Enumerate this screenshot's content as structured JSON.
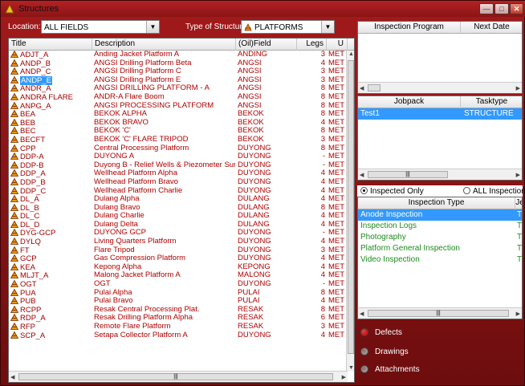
{
  "window": {
    "title": "Structures",
    "min": "—",
    "max": "□",
    "close": "✕"
  },
  "toolbar": {
    "location_label": "Location:",
    "location_value": "ALL FIELDS",
    "type_label": "Type of Structure:",
    "type_value": "PLATFORMS"
  },
  "grid": {
    "headers": [
      "Title",
      "Description",
      "(Oil)Field",
      "Legs",
      "U"
    ],
    "rows": [
      [
        "ADJT_A",
        "Anding Jacket Platform A",
        "ANDING",
        "3",
        "MET"
      ],
      [
        "ANDP_B",
        "ANGSI Drilling Platform Beta",
        "ANGSI",
        "4",
        "MET"
      ],
      [
        "ANDP_C",
        "ANGSI Drilling Platform C",
        "ANGSI",
        "3",
        "MET"
      ],
      [
        "ANDP_E",
        "ANGSI Drilling Platform E",
        "ANGSI",
        "3",
        "MET"
      ],
      [
        "ANDR_A",
        "ANGSI DRILLING PLATFORM - A",
        "ANGSI",
        "8",
        "MET"
      ],
      [
        "ANDRA FLARE",
        "ANDR-A Flare Boom",
        "ANGSI",
        "8",
        "MET"
      ],
      [
        "ANPG_A",
        "ANGSI PROCESSING PLATFORM",
        "ANGSI",
        "8",
        "MET"
      ],
      [
        "BEA",
        "BEKOK  ALPHA",
        "BEKOK",
        "8",
        "MET"
      ],
      [
        "BEB",
        "BEKOK  BRAVO",
        "BEKOK",
        "4",
        "MET"
      ],
      [
        "BEC",
        "BEKOK 'C'",
        "BEKOK",
        "8",
        "MET"
      ],
      [
        "BECFT",
        "BEKOK 'C' FLARE TRIPOD",
        "BEKOK",
        "3",
        "MET"
      ],
      [
        "CPP",
        "Central Processing Platform",
        "DUYONG",
        "8",
        "MET"
      ],
      [
        "DDP-A",
        "DUYONG A",
        "DUYONG",
        "-",
        "MET"
      ],
      [
        "DDP-B",
        "Duyong B - Relief Wells & Piezometer Surv...",
        "DUYONG",
        "-",
        "MET"
      ],
      [
        "DDP_A",
        "Wellhead Platform Alpha",
        "DUYONG",
        "4",
        "MET"
      ],
      [
        "DDP_B",
        "Wellhead Platform Bravo",
        "DUYONG",
        "4",
        "MET"
      ],
      [
        "DDP_C",
        "Wellhead Platform Charlie",
        "DUYONG",
        "4",
        "MET"
      ],
      [
        "DL_A",
        "Dulang Alpha",
        "DULANG",
        "4",
        "MET"
      ],
      [
        "DL_B",
        "Dulang Bravo",
        "DULANG",
        "8",
        "MET"
      ],
      [
        "DL_C",
        "Dulang Charlie",
        "DULANG",
        "4",
        "MET"
      ],
      [
        "DL_D",
        "Dulang Delta",
        "DULANG",
        "4",
        "MET"
      ],
      [
        "DYG-GCP",
        "DUYONG GCP",
        "DUYONG",
        "-",
        "MET"
      ],
      [
        "DYLQ",
        "Living Quarters Platform",
        "DUYONG",
        "4",
        "MET"
      ],
      [
        "FT",
        "Flare Tripod",
        "DUYONG",
        "3",
        "MET"
      ],
      [
        "GCP",
        "Gas Compression Platform",
        "DUYONG",
        "4",
        "MET"
      ],
      [
        "KEA",
        "Kepong Alpha",
        "KEPONG",
        "4",
        "MET"
      ],
      [
        "MLJT_A",
        "Malong Jacket Platform A",
        "MALONG",
        "4",
        "MET"
      ],
      [
        "OGT",
        "OGT",
        "DUYONG",
        "-",
        "MET"
      ],
      [
        "PUA",
        "Pulai Alpha",
        "PULAI",
        "8",
        "MET"
      ],
      [
        "PUB",
        "Pulai Bravo",
        "PULAI",
        "4",
        "MET"
      ],
      [
        "RCPP",
        "Resak Central Processing Plat.",
        "RESAK",
        "8",
        "MET"
      ],
      [
        "RDP_A",
        "Resak Drilling Platform Alpha",
        "RESAK",
        "6",
        "MET"
      ],
      [
        "RFP",
        "Remote Flare Platform",
        "RESAK",
        "3",
        "MET"
      ],
      [
        "SCP_A",
        "Setapa Collector Platform A",
        "DUYONG",
        "4",
        "MET"
      ]
    ],
    "selected_row": 3
  },
  "program_panel": {
    "headers": [
      "Inspection Program",
      "Next Date"
    ]
  },
  "jobpack_panel": {
    "headers": [
      "Jobpack",
      "Tasktype"
    ],
    "rows": [
      [
        "Test1",
        "STRUCTURE"
      ]
    ]
  },
  "filter": {
    "inspected_only": "Inspected Only",
    "all": "ALL Inspection"
  },
  "type_panel": {
    "headers": [
      "Inspection Type",
      "Je"
    ],
    "rows": [
      [
        "Anode Inspection",
        "T"
      ],
      [
        "Inspection Logs",
        "T"
      ],
      [
        "Photography",
        "T"
      ],
      [
        "Platform General Inspection",
        "T"
      ],
      [
        "Video Inspection",
        "T"
      ]
    ]
  },
  "legend": {
    "defects": "Defects",
    "drawings": "Drawings",
    "attachments": "Attachments",
    "defects_color": "#e01010",
    "drawings_color": "#9a9a9a",
    "attachments_color": "#9a9a9a"
  }
}
